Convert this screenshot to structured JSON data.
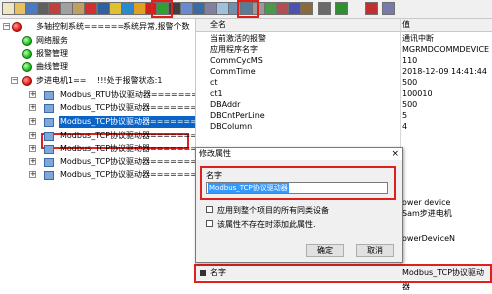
{
  "toolbar": {
    "icons": [
      "new-icon",
      "open-icon",
      "save-icon",
      "print-icon",
      "cut-icon",
      "copy-icon",
      "paste-icon",
      "delete-icon",
      "undo-icon",
      "tag-icon",
      "globe-icon",
      "warning-icon",
      "alarm-icon",
      "power-icon",
      "pointer-icon",
      "device-icon",
      "help-icon",
      "grid-icon",
      "table-icon",
      "list-icon",
      "filter-icon",
      "zoom-icon",
      "chart-icon",
      "export-icon",
      "import-icon",
      "config-icon",
      "log-icon",
      "run-icon",
      "stop-icon",
      "window-icon"
    ]
  },
  "tree": {
    "root": {
      "label": "多轴控制系统======",
      "status": "系统异常,报警个数"
    },
    "items": [
      {
        "label": "网络服务"
      },
      {
        "label": "报警管理"
      },
      {
        "label": "曲线管理"
      }
    ],
    "motor": {
      "label": "步进电机1==",
      "status": "!!!处于报警状态:1"
    },
    "drivers": [
      {
        "label": "Modbus_RTU协议驱动器======="
      },
      {
        "label": "Modbus_TCP协议驱动器======="
      },
      {
        "label": "Modbus_TCP协议驱动器======="
      },
      {
        "label": "Modbus_TCP协议驱动器======="
      },
      {
        "label": "Modbus_TCP协议驱动器======="
      },
      {
        "label": "Modbus_TCP协议驱动器======="
      },
      {
        "label": "Modbus_TCP协议驱动器======="
      }
    ]
  },
  "grid": {
    "header_name": "全名",
    "header_value": "值",
    "rows": [
      {
        "key": "当前激活的报警",
        "value": "通讯中断"
      },
      {
        "key": "应用程序名字",
        "value": "MGRMDCOMMDEVICE"
      },
      {
        "key": "CommCycMS",
        "value": "110"
      },
      {
        "key": "CommTime",
        "value": "2018-12-09 14:41:44"
      },
      {
        "key": "ct",
        "value": "500"
      },
      {
        "key": "ct1",
        "value": "100010"
      },
      {
        "key": "DBAddr",
        "value": "500"
      },
      {
        "key": "DBCntPerLine",
        "value": "5"
      },
      {
        "key": "DBColumn",
        "value": "4"
      }
    ],
    "partial_values": [
      "ower device",
      "Sam步进电机",
      "owerDeviceN"
    ],
    "bottom_key": "名字",
    "bottom_value": "Modbus_TCP协议驱动器"
  },
  "dialog": {
    "title": "修改属性",
    "close_glyph": "×",
    "name_label": "名字",
    "name_value": "Modbus_TCP协议驱动器",
    "apply_all_label": "应用到整个项目的所有同类设备",
    "create_if_missing_label": "该属性不存在时添加此属性.",
    "ok_label": "确定",
    "cancel_label": "取消"
  },
  "colors": {
    "highlight": "#e0201c",
    "selection": "#0a64c8"
  }
}
